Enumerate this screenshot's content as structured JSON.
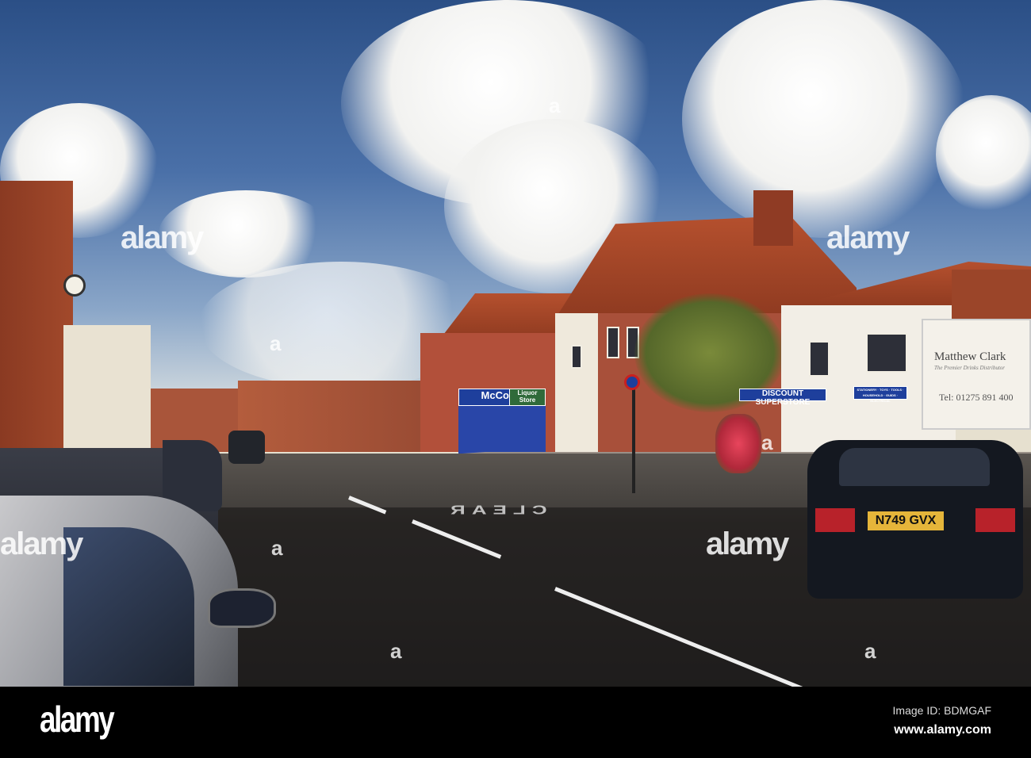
{
  "watermark": {
    "brand": "alamy",
    "letter": "a"
  },
  "footer": {
    "logo": "alamy",
    "image_id": "Image ID: BDMGAF",
    "url": "www.alamy.com"
  },
  "scene": {
    "lorry_brand": "Matthew Clark",
    "lorry_tagline": "The Premier Drinks Distributor",
    "lorry_phone": "Tel: 01275 891 400",
    "shop_sign_1": "DISCOUNT SUPERSTORE",
    "shop_sign_2": "STATIONERY · TOYS · TOOLS · HOUSEHOLD · GUIDS · ELECTRICAL",
    "shop_sign_3": "McColl's",
    "shop_sign_4": "Liquor Store",
    "number_plate": "N749 GVX",
    "road_marking": "CLEAR"
  }
}
